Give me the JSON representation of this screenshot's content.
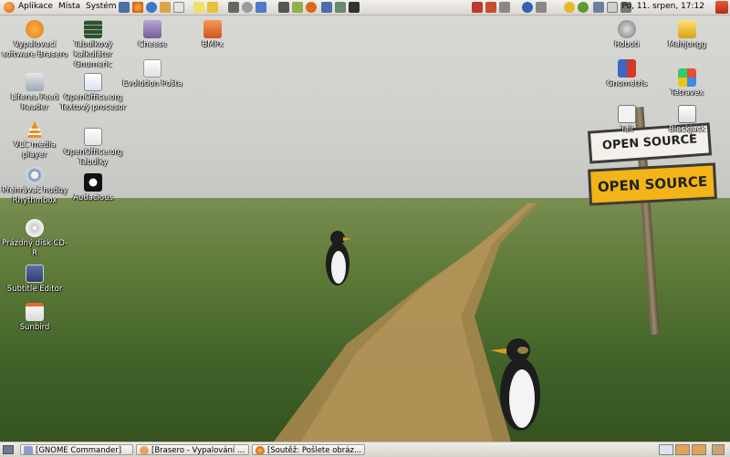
{
  "top_panel": {
    "menus": [
      "Aplikace",
      "Místa",
      "Systém"
    ],
    "clock": "Po, 11. srpen, 17:12"
  },
  "desktop_icons_left": [
    {
      "label": "Vypalovací software Brasero",
      "icon": "brasero-icon"
    },
    {
      "label": "Liferea Feed Reader",
      "icon": "liferea-icon"
    },
    {
      "label": "VLC media player",
      "icon": "vlc-icon"
    },
    {
      "label": "Přehrávač hudby Rhythmbox",
      "icon": "rhythmbox-icon"
    },
    {
      "label": "Prázdný disk CD-R",
      "icon": "cd-icon"
    },
    {
      "label": "Subtitle Editor",
      "icon": "subtitle-editor-icon"
    },
    {
      "label": "Sunbird",
      "icon": "sunbird-icon"
    },
    {
      "label": "Tabulkový kalkulátor Gnumeric",
      "icon": "gnumeric-icon"
    },
    {
      "label": "OpenOffice.org Textový procesor",
      "icon": "writer-icon"
    },
    {
      "label": "OpenOffice.org Tabulky",
      "icon": "calc-icon"
    },
    {
      "label": "Audacious",
      "icon": "audacious-icon"
    },
    {
      "label": "Cheese",
      "icon": "cheese-icon"
    },
    {
      "label": "Evolution Pošta",
      "icon": "evolution-icon"
    },
    {
      "label": "BMPx",
      "icon": "bmpx-icon"
    }
  ],
  "desktop_icons_right": [
    {
      "label": "Roboti",
      "icon": "robots-icon"
    },
    {
      "label": "Mahjongg",
      "icon": "mahjongg-icon"
    },
    {
      "label": "Gnometris",
      "icon": "gnometris-icon"
    },
    {
      "label": "Tetravex",
      "icon": "tetravex-icon"
    },
    {
      "label": "Tali",
      "icon": "tali-icon"
    },
    {
      "label": "Blackjack",
      "icon": "blackjack-icon"
    }
  ],
  "wallpaper": {
    "sign_top": "OPEN SOURCE",
    "sign_bottom": "OPEN SOURCE"
  },
  "taskbar": [
    {
      "label": "[GNOME Commander]",
      "icon": "gnome-commander-icon"
    },
    {
      "label": "[Brasero - Vypalování ...",
      "icon": "brasero-icon"
    },
    {
      "label": "[Soutěž: Pošlete obráz...",
      "icon": "firefox-icon"
    }
  ],
  "colors": {
    "panel": "#dedbd4",
    "accent": "#e07b17",
    "sign_yellow": "#f2b417"
  }
}
